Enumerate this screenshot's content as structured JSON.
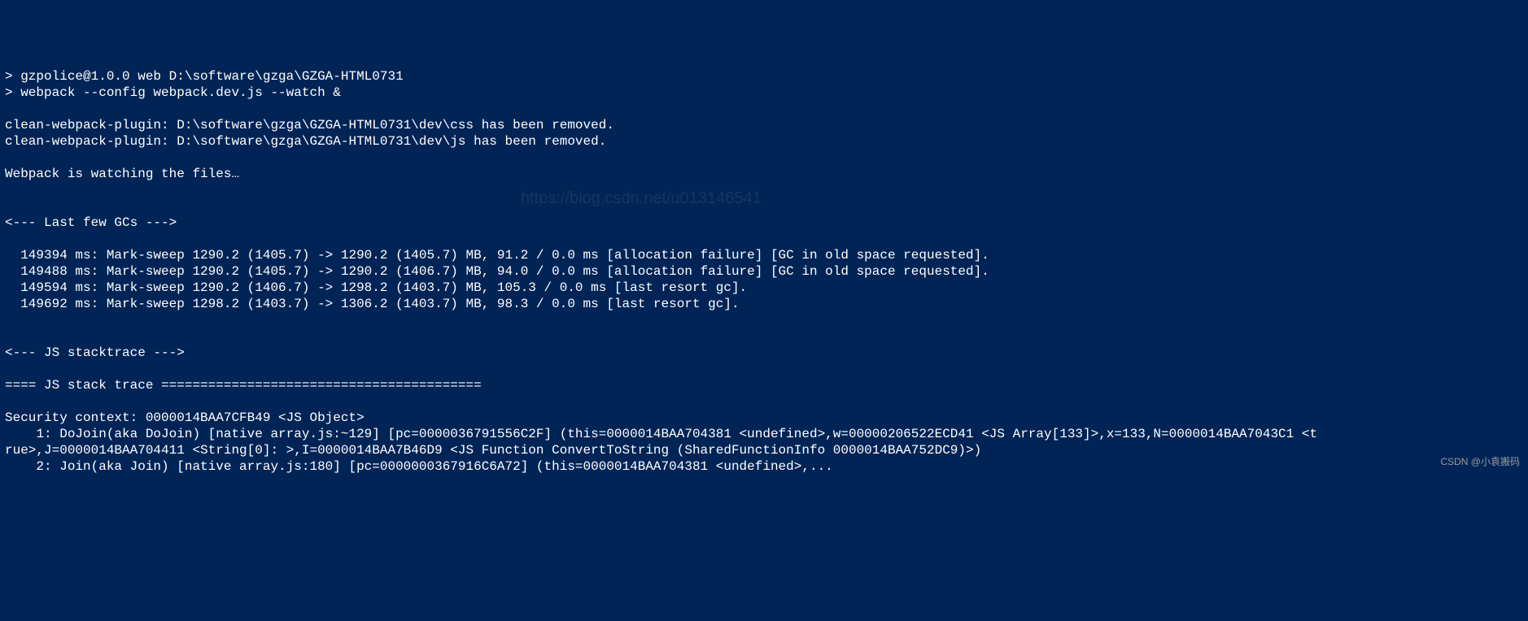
{
  "terminal": {
    "lines": [
      "> gzpolice@1.0.0 web D:\\software\\gzga\\GZGA-HTML0731",
      "> webpack --config webpack.dev.js --watch &",
      "",
      "clean-webpack-plugin: D:\\software\\gzga\\GZGA-HTML0731\\dev\\css has been removed.",
      "clean-webpack-plugin: D:\\software\\gzga\\GZGA-HTML0731\\dev\\js has been removed.",
      "",
      "Webpack is watching the files…",
      "",
      "",
      "<--- Last few GCs --->",
      "",
      "  149394 ms: Mark-sweep 1290.2 (1405.7) -> 1290.2 (1405.7) MB, 91.2 / 0.0 ms [allocation failure] [GC in old space requested].",
      "  149488 ms: Mark-sweep 1290.2 (1405.7) -> 1290.2 (1406.7) MB, 94.0 / 0.0 ms [allocation failure] [GC in old space requested].",
      "  149594 ms: Mark-sweep 1290.2 (1406.7) -> 1298.2 (1403.7) MB, 105.3 / 0.0 ms [last resort gc].",
      "  149692 ms: Mark-sweep 1298.2 (1403.7) -> 1306.2 (1403.7) MB, 98.3 / 0.0 ms [last resort gc].",
      "",
      "",
      "<--- JS stacktrace --->",
      "",
      "==== JS stack trace =========================================",
      "",
      "Security context: 0000014BAA7CFB49 <JS Object>",
      "    1: DoJoin(aka DoJoin) [native array.js:~129] [pc=0000036791556C2F] (this=0000014BAA704381 <undefined>,w=00000206522ECD41 <JS Array[133]>,x=133,N=0000014BAA7043C1 <t",
      "rue>,J=0000014BAA704411 <String[0]: >,I=0000014BAA7B46D9 <JS Function ConvertToString (SharedFunctionInfo 0000014BAA752DC9)>)",
      "    2: Join(aka Join) [native array.js:180] [pc=0000000367916C6A72] (this=0000014BAA704381 <undefined>,..."
    ]
  },
  "watermark": "https://blog.csdn.net/u013146541",
  "attribution": "CSDN @小袁搬码"
}
